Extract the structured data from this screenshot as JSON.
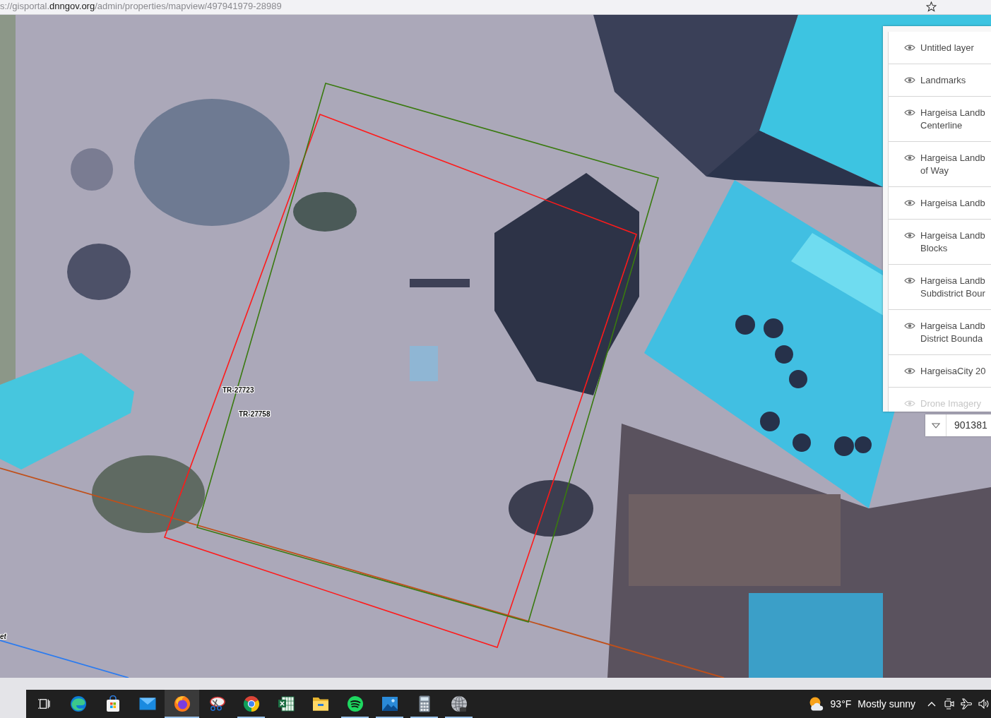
{
  "address_bar": {
    "url": {
      "prefix": "s://gisportal.",
      "domain": "dnngov.org",
      "path": "/admin/properties/mapview/497941979-28989"
    }
  },
  "map": {
    "parcels": [
      {
        "color": "#ff1a1a"
      },
      {
        "color": "#3a7a10"
      }
    ],
    "lines": [
      {
        "color": "#c0501a"
      },
      {
        "color": "#2a7bf0"
      }
    ],
    "labels": [
      {
        "kind": "parcel",
        "text": "TR-27723"
      },
      {
        "kind": "parcel",
        "text": "TR-27758"
      },
      {
        "kind": "street",
        "text": "et"
      }
    ],
    "layer_list": {
      "layers": [
        {
          "lines": [
            "Untitled layer"
          ],
          "visible": true,
          "dimmed": false
        },
        {
          "lines": [
            "Landmarks"
          ],
          "visible": true,
          "dimmed": false
        },
        {
          "lines": [
            "Hargeisa Landb",
            "Centerline"
          ],
          "visible": true,
          "dimmed": false
        },
        {
          "lines": [
            "Hargeisa Landb",
            "of Way"
          ],
          "visible": true,
          "dimmed": false
        },
        {
          "lines": [
            "Hargeisa Landb"
          ],
          "visible": true,
          "dimmed": false
        },
        {
          "lines": [
            "Hargeisa Landb",
            "Blocks"
          ],
          "visible": true,
          "dimmed": false
        },
        {
          "lines": [
            "Hargeisa Landb",
            "Subdistrict Bour"
          ],
          "visible": true,
          "dimmed": false
        },
        {
          "lines": [
            "Hargeisa Landb",
            "District Bounda"
          ],
          "visible": true,
          "dimmed": false
        },
        {
          "lines": [
            "HargeisaCity 20"
          ],
          "visible": true,
          "dimmed": false
        },
        {
          "lines": [
            "Drone Imagery"
          ],
          "visible": true,
          "dimmed": true
        }
      ]
    },
    "scale_field": {
      "value": "901381"
    }
  },
  "taskbar": {
    "apps": [
      {
        "running": false,
        "selected": false
      },
      {
        "running": false,
        "selected": false
      },
      {
        "running": false,
        "selected": false
      },
      {
        "running": true,
        "selected": true
      },
      {
        "running": false,
        "selected": false
      },
      {
        "running": true,
        "selected": false
      },
      {
        "running": false,
        "selected": false
      },
      {
        "running": false,
        "selected": false
      },
      {
        "running": true,
        "selected": false
      },
      {
        "running": true,
        "selected": false
      },
      {
        "running": true,
        "selected": false
      },
      {
        "running": true,
        "selected": false
      }
    ],
    "weather": {
      "temperature": "93°F",
      "condition": "Mostly sunny"
    }
  }
}
